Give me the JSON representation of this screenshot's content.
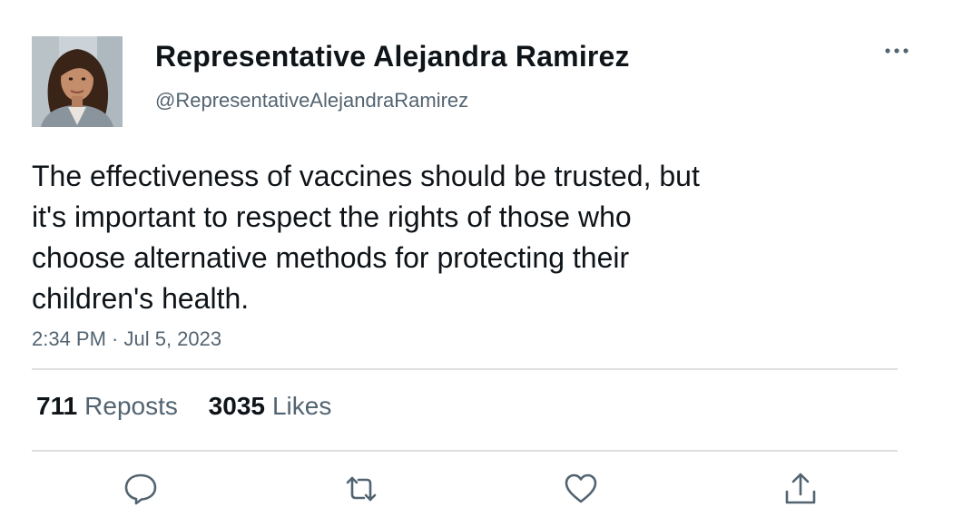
{
  "author": {
    "display_name": "Representative Alejandra Ramirez",
    "handle": "@RepresentativeAlejandraRamirez",
    "avatar_icon": "profile-photo"
  },
  "tweet": {
    "text_lines": [
      "The effectiveness of vaccines should be trusted, but",
      "it's important to respect the rights of those who",
      "choose alternative methods for protecting their",
      "children's health."
    ],
    "timestamp": "2:34 PM · Jul 5, 2023"
  },
  "stats": {
    "reposts_count": "711",
    "reposts_label": "Reposts",
    "likes_count": "3035",
    "likes_label": "Likes"
  },
  "actions": {
    "reply_icon": "reply-icon",
    "repost_icon": "repost-icon",
    "like_icon": "heart-icon",
    "share_icon": "share-icon",
    "more_icon": "more-icon"
  },
  "colors": {
    "primary_text": "#0f1419",
    "secondary_text": "#536471",
    "divider": "#dcdfe2",
    "icon": "#536471"
  }
}
